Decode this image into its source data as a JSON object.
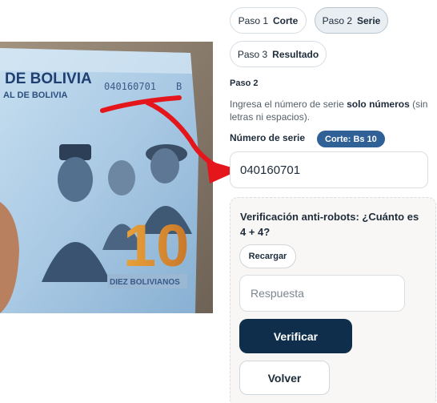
{
  "steps": [
    {
      "num": "Paso 1",
      "label": "Corte",
      "active": false
    },
    {
      "num": "Paso 2",
      "label": "Serie",
      "active": true
    },
    {
      "num": "Paso 3",
      "label": "Resultado",
      "active": false
    }
  ],
  "step_title": "Paso 2",
  "help": {
    "before": "Ingresa el número de serie ",
    "bold": "solo números",
    "after": " (sin letras ni espacios)."
  },
  "serial": {
    "label": "Número de serie",
    "badge": "Corte: Bs 10",
    "value": "040160701"
  },
  "captcha": {
    "question": "Verificación anti-robots: ¿Cuánto es 4 + 4?",
    "reload_label": "Recargar",
    "answer_placeholder": "Respuesta",
    "verify_label": "Verificar",
    "back_label": "Volver"
  },
  "banknote": {
    "header_text": "DE BOLIVIA",
    "subheader_text": "AL DE BOLIVIA",
    "serial_print": "040160701",
    "serial_letter": "B",
    "denomination": "10",
    "denomination_words": "DIEZ BOLIVIANOS"
  },
  "colors": {
    "accent": "#2f6096",
    "primary_button": "#0f2e4b",
    "annotation_red": "#e4161c"
  }
}
